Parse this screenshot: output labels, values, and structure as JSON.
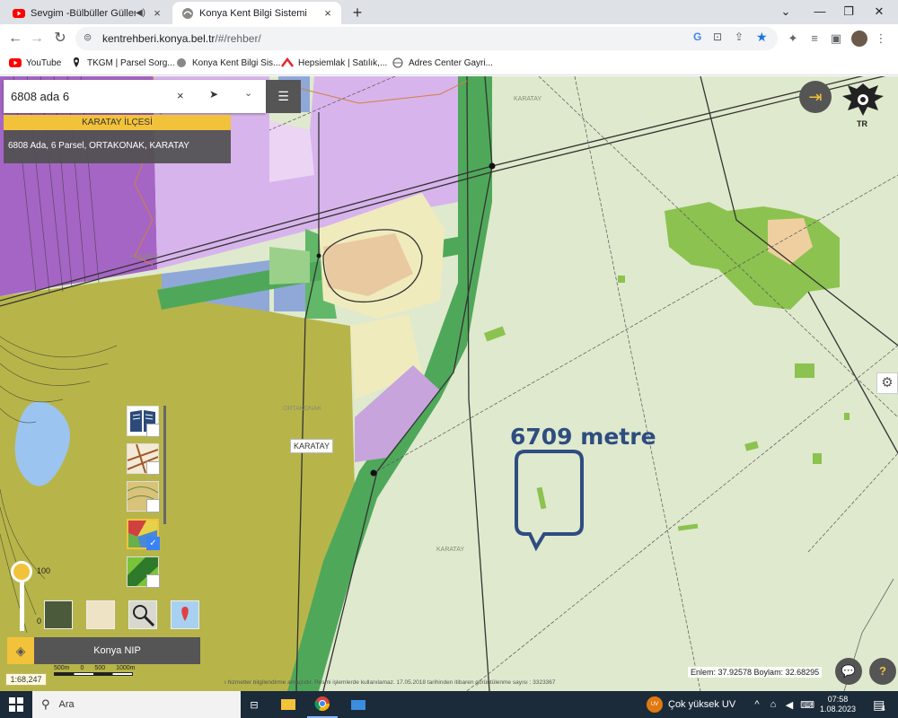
{
  "browser": {
    "tabs": [
      {
        "title": "Sevgim -Bülbüller Güllere Gü",
        "active": false
      },
      {
        "title": "Konya Kent Bilgi Sistemi",
        "active": true
      }
    ],
    "new_tab": "+",
    "url_host": "kentrehberi.konya.bel.tr",
    "url_path": "/#/rehber/",
    "window_controls": {
      "minimize": "⌄",
      "min": "—",
      "restore": "❐",
      "close": "✕"
    }
  },
  "bookmarks": [
    "YouTube",
    "TKGM | Parsel Sorg...",
    "Konya Kent Bilgi Sis...",
    "Hepsiemlak | Satılık,...",
    "Adres Center Gayri..."
  ],
  "map": {
    "search_value": "6808 ada 6",
    "district": "KARATAY İLÇESİ",
    "result": "6808 Ada, 6 Parsel, ORTAKONAK, KARATAY",
    "labels": [
      "KARATAY",
      "KARATAY",
      "ORTAKONAK",
      "KARATAY"
    ],
    "karatay_box": "KARATAY",
    "annotation": "6709 metre",
    "emblem_text": "TR",
    "opacity_max": "100",
    "opacity_min": "0",
    "layer_panel": "Konya NIP",
    "scale": "1:68,247",
    "scalebar": [
      "500m",
      "0",
      "500",
      "1000m"
    ],
    "coords": "Enlem: 37.92578 Boylam: 32.68295",
    "attribution": "ı hizmetler bilgilendirme amaçlıdır. Resmi işlemlerde kullanılamaz. 17.05.2018 tarihinden itibaren görüntülenme sayısı : 3323367"
  },
  "taskbar": {
    "search": "Ara",
    "uv": "Çok yüksek UV",
    "time": "07:58",
    "date": "1.08.2023",
    "notif": "4",
    "uv_badge": "UV"
  },
  "colors": {
    "accent": "#f3c23b",
    "annotation": "#2e4d80",
    "panel": "#555555"
  }
}
